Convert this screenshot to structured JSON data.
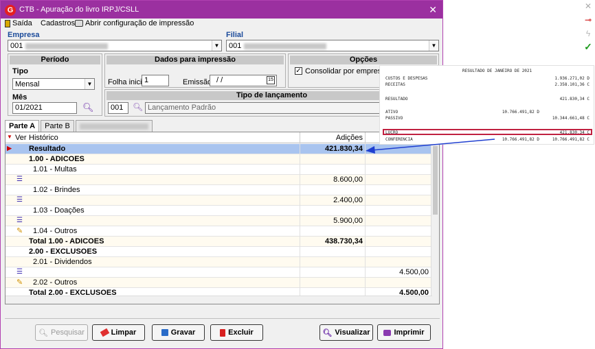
{
  "window": {
    "title": "CTB - Apuração do livro IRPJ/CSLL",
    "app_icon": "G"
  },
  "menu": {
    "exit": "Saída",
    "registrations": "Cadastros",
    "print_config": "Abrir configuração de impressão"
  },
  "company": {
    "label": "Empresa",
    "value": "001"
  },
  "branch": {
    "label": "Filial",
    "value": "001"
  },
  "period": {
    "header": "Período",
    "type_label": "Tipo",
    "type_value": "Mensal",
    "month_label": "Mês",
    "month_value": "01/2021"
  },
  "print_data": {
    "header": "Dados para impressão",
    "first_page_label": "Folha inicial",
    "first_page_value": "1",
    "issue_label": "Emissão",
    "issue_value": "/ /"
  },
  "options": {
    "header": "Opções",
    "consolidate_label": "Consolidar por empresa",
    "consolidate_checked": "✓"
  },
  "entry_type": {
    "header": "Tipo de lançamento",
    "code": "001",
    "description": "Lançamento Padrão"
  },
  "tabs": [
    "Parte A",
    "Parte B"
  ],
  "grid": {
    "headers": {
      "ver": "Ver",
      "history": "Histórico",
      "additions": "Adições"
    },
    "rows": [
      {
        "history": "Resultado",
        "additions": "421.830,34",
        "exclusions": ""
      },
      {
        "history": "1.00 - ADICOES",
        "additions": "",
        "exclusions": ""
      },
      {
        "history": "1.01 - Multas",
        "additions": "",
        "exclusions": ""
      },
      {
        "history": "",
        "additions": "8.600,00",
        "exclusions": ""
      },
      {
        "history": "1.02 - Brindes",
        "additions": "",
        "exclusions": ""
      },
      {
        "history": "",
        "additions": "2.400,00",
        "exclusions": ""
      },
      {
        "history": "1.03 - Doações",
        "additions": "",
        "exclusions": ""
      },
      {
        "history": "",
        "additions": "5.900,00",
        "exclusions": ""
      },
      {
        "history": "1.04 - Outros",
        "additions": "",
        "exclusions": ""
      },
      {
        "history": "Total 1.00 - ADICOES",
        "additions": "438.730,34",
        "exclusions": ""
      },
      {
        "history": "2.00 - EXCLUSOES",
        "additions": "",
        "exclusions": ""
      },
      {
        "history": "2.01 - Dividendos",
        "additions": "",
        "exclusions": ""
      },
      {
        "history": "",
        "additions": "",
        "exclusions": "4.500,00"
      },
      {
        "history": "2.02 - Outros",
        "additions": "",
        "exclusions": ""
      },
      {
        "history": "Total 2.00 - EXCLUSOES",
        "additions": "",
        "exclusions": "4.500,00"
      }
    ]
  },
  "buttons": {
    "search": "Pesquisar",
    "clear": "Limpar",
    "save": "Gravar",
    "delete": "Excluir",
    "view": "Visualizar",
    "print": "Imprimir"
  },
  "report": {
    "title": "RESULTADO DE JANEIRO DE 2021",
    "lines": [
      {
        "label": "CUSTOS E DESPESAS",
        "col1": "",
        "col2": "1.936.271,02 D"
      },
      {
        "label": "RECEITAS",
        "col1": "",
        "col2": "2.358.101,36 C"
      },
      {
        "label": "RESULTADO",
        "col1": "",
        "col2": "421.830,34 C"
      },
      {
        "label": "ATIVO",
        "col1": "10.766.491,82 D",
        "col2": ""
      },
      {
        "label": "PASSIVO",
        "col1": "",
        "col2": "10.344.661,48 C"
      },
      {
        "label": "LUCRO",
        "col1": "",
        "col2": "421.830,34 C"
      },
      {
        "label": "CONFERENCIA",
        "col1": "10.766.491,82 D",
        "col2": "10.766.491,82 C"
      }
    ]
  },
  "colors": {
    "titlebar": "#9b30a0",
    "selected_row": "#a9c4ef",
    "highlight_box": "#c02040",
    "arrow": "#1f3fd0"
  }
}
